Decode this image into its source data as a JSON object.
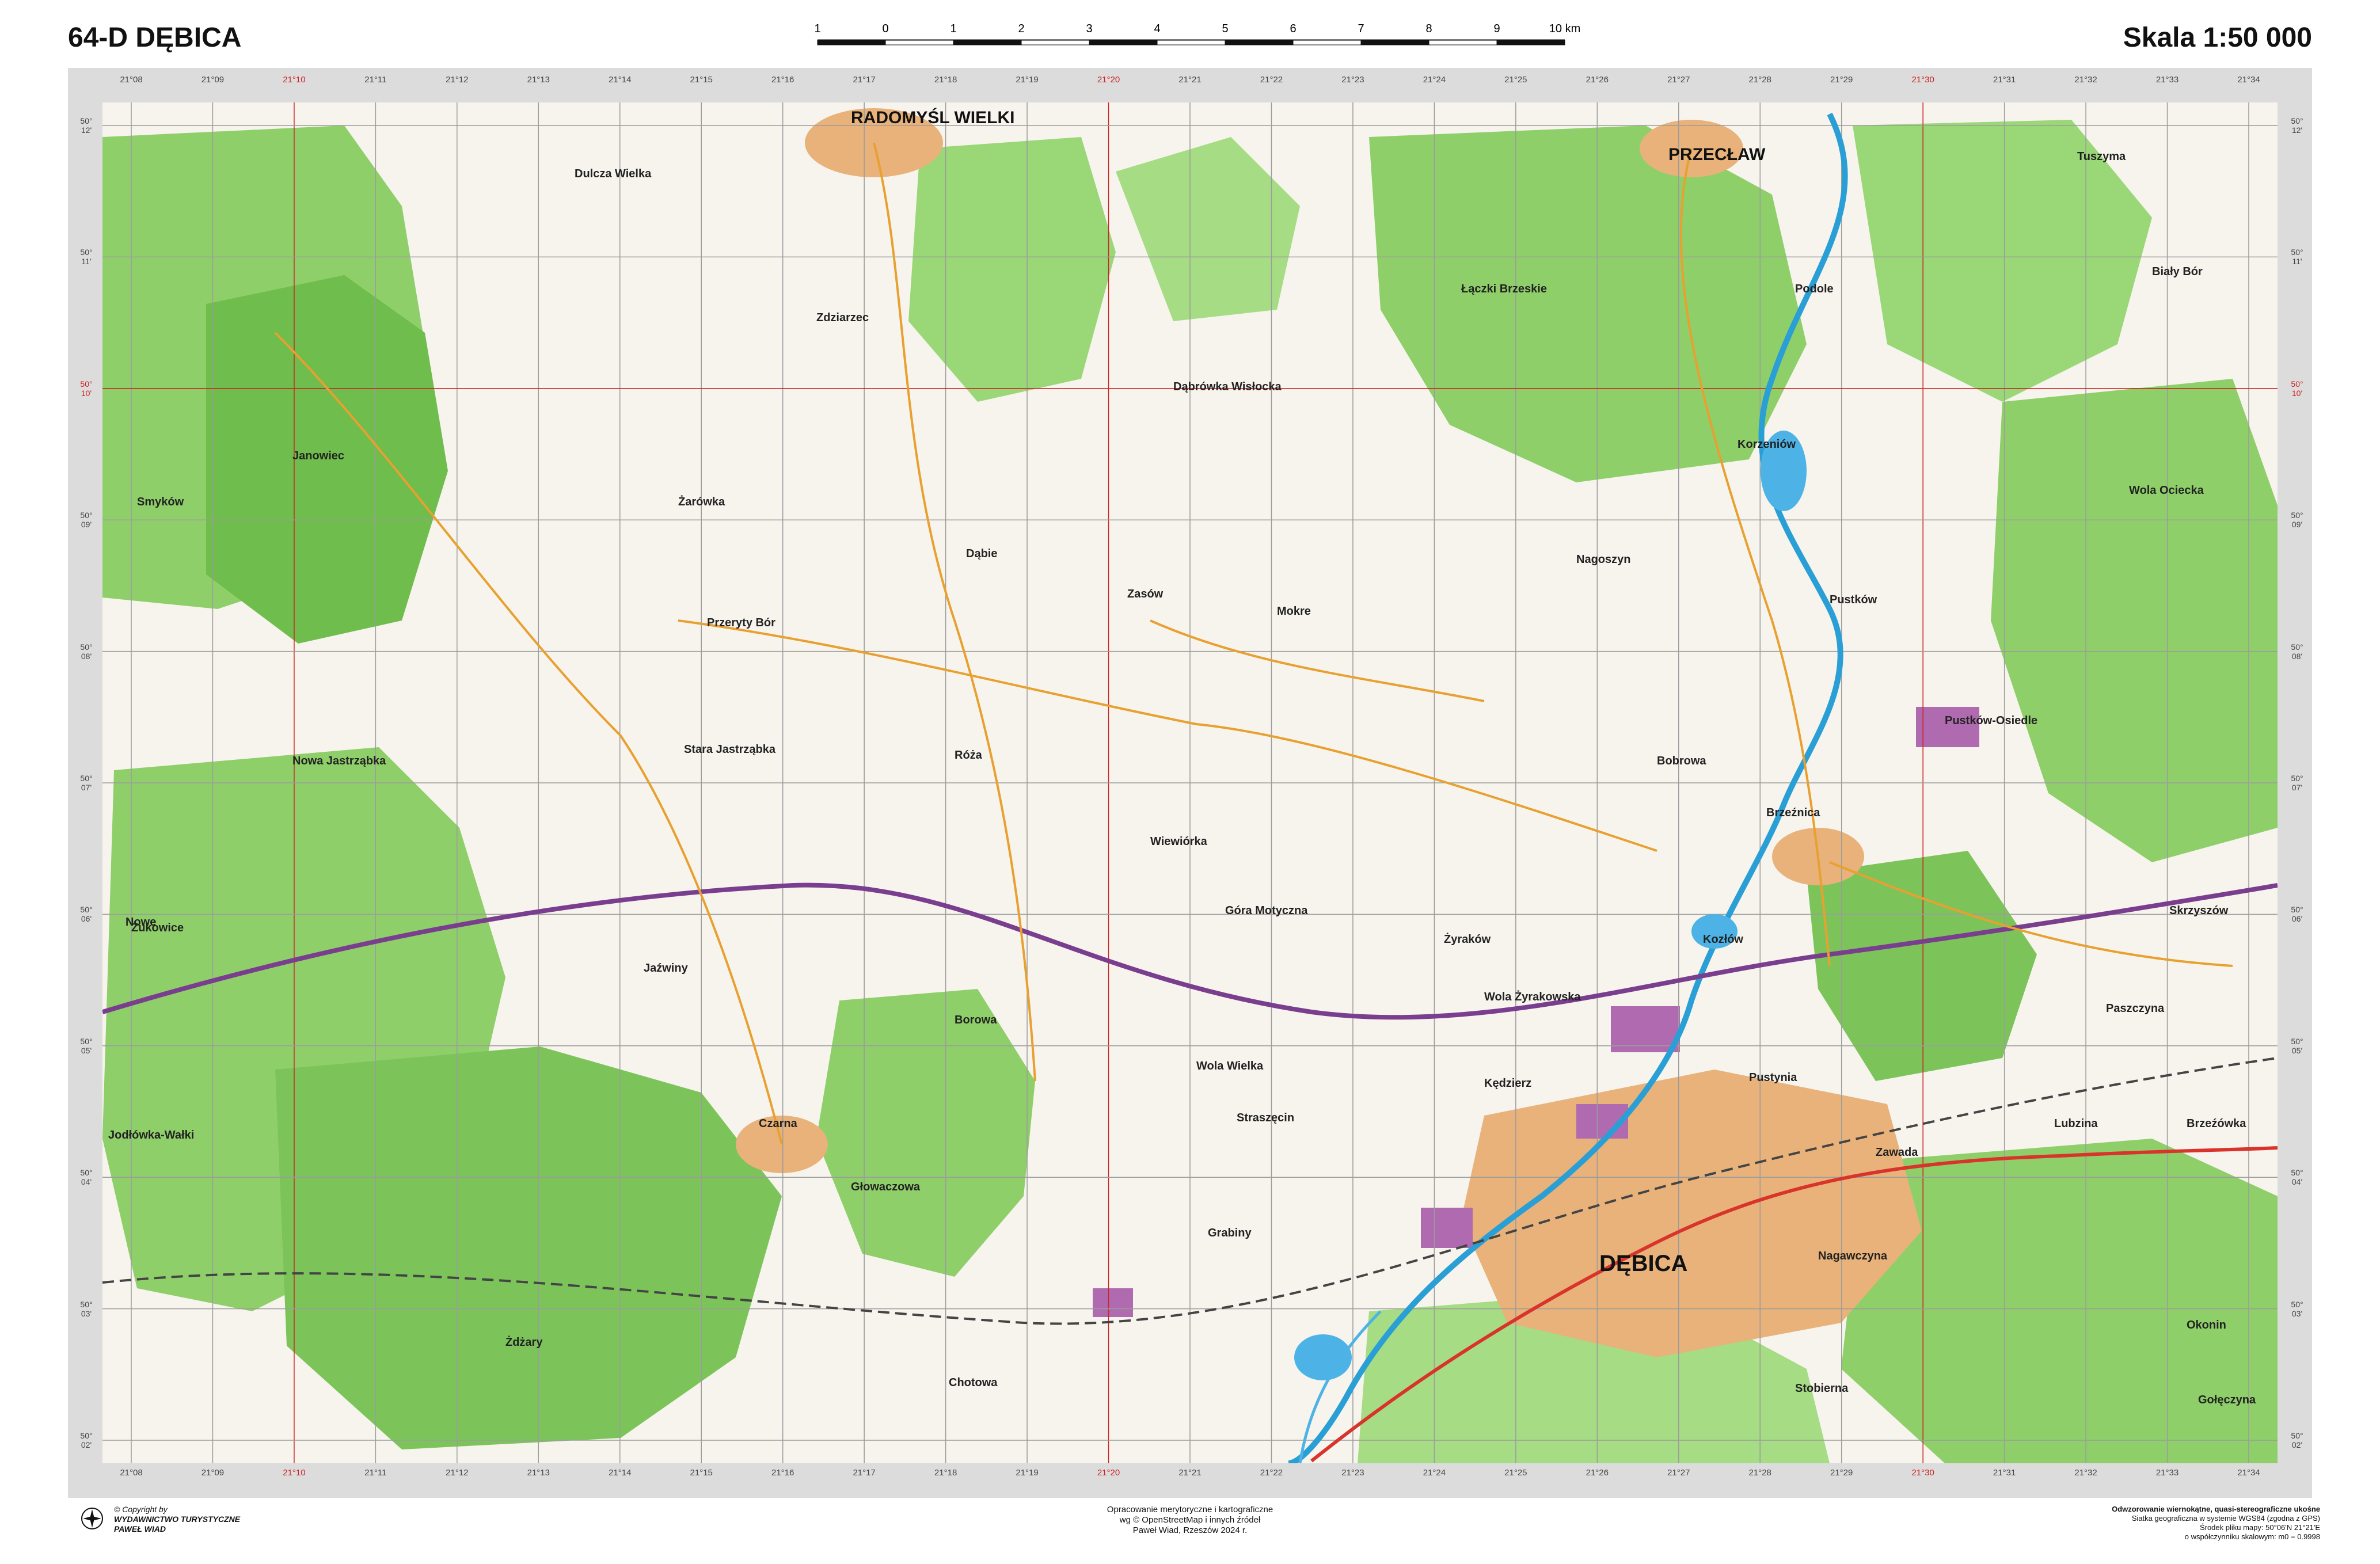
{
  "header": {
    "sheet_title": "64-D DĘBICA",
    "scale_title": "Skala 1:50 000",
    "scalebar_labels": [
      "1",
      "0",
      "1",
      "2",
      "3",
      "4",
      "5",
      "6",
      "7",
      "8",
      "9",
      "10 km"
    ]
  },
  "longitude_ticks": [
    "21°08",
    "21°09",
    "21°10",
    "21°11",
    "21°12",
    "21°13",
    "21°14",
    "21°15",
    "21°16",
    "21°17",
    "21°18",
    "21°19",
    "21°20",
    "21°21",
    "21°22",
    "21°23",
    "21°24",
    "21°25",
    "21°26",
    "21°27",
    "21°28",
    "21°29",
    "21°30",
    "21°31",
    "21°32",
    "21°33",
    "21°34"
  ],
  "longitude_red": [
    "21°10",
    "21°20",
    "21°30"
  ],
  "latitude_ticks": [
    "50° 12'",
    "50° 11'",
    "50° 10'",
    "50° 09'",
    "50° 08'",
    "50° 07'",
    "50° 06'",
    "50° 05'",
    "50° 04'",
    "50° 03'",
    "50° 02'"
  ],
  "latitude_red": [
    "50° 10'"
  ],
  "colors": {
    "forest": "#8fcf6a",
    "forest_dark": "#5fae3f",
    "field": "#f7f4ee",
    "water": "#2a9fd6",
    "lake": "#4db3e6",
    "urban": "#e8b27a",
    "industrial": "#b06ab0",
    "road_main": "#d8342c",
    "road_minor": "#e8a030",
    "railway": "#444444",
    "motorway": "#7a3e8f",
    "grid": "#9c9c9c"
  },
  "map": {
    "towns_major": [
      {
        "name": "RADOMYŚL WIELKI"
      },
      {
        "name": "PRZECŁAW"
      },
      {
        "name": "DĘBICA"
      }
    ],
    "places": [
      "Dulcza Wielka",
      "Zdziarzec",
      "Dąbrówka Wisłocka",
      "Łączki Brzeskie",
      "Podole",
      "Tuszyma",
      "Biały Bór",
      "Janowiec",
      "Żarówka",
      "Smyków",
      "Korzeniów",
      "Wola Ociecka",
      "Dąbie",
      "Zasów",
      "Mokre",
      "Nagoszyn",
      "Pustków",
      "Przeryty Bór",
      "Nowa Jastrząbka",
      "Stara Jastrząbka",
      "Róża",
      "Wiewiórka",
      "Bobrowa",
      "Brzeźnica",
      "Pustków-Osiedle",
      "Góra Motyczna",
      "Żyraków",
      "Wola Żyrakowska",
      "Kozłów",
      "Skrzyszów",
      "Nowe",
      "Żukowice",
      "Jaźwiny",
      "Borowa",
      "Wola Wielka",
      "Kędzierz",
      "Pustynia",
      "Paszczyna",
      "Czarna",
      "Głowaczowa",
      "Straszęcin",
      "Lubzina",
      "Brzeźówka",
      "Zawada",
      "Grabiny",
      "Nagawczyna",
      "Jodłówka-Wałki",
      "Żdżary",
      "Chotowa",
      "Stobierna",
      "Okonin",
      "Gołęczyna"
    ]
  },
  "footer": {
    "copyright_lines": [
      "© Copyright by",
      "WYDAWNICTWO TURYSTYCZNE",
      "PAWEŁ WIAD"
    ],
    "center_lines": [
      "Opracowanie merytoryczne i kartograficzne",
      "wg © OpenStreetMap i innych źródeł",
      "Paweł Wiad, Rzeszów 2024 r."
    ],
    "right_lines": [
      "Odwzorowanie wiernokątne, quasi-stereograficzne ukośne",
      "Siatka geograficzna w systemie WGS84 (zgodna z GPS)",
      "Środek pliku mapy: 50°06'N 21°21'E",
      "o współczynniku skalowym: m0 = 0.9998"
    ]
  }
}
